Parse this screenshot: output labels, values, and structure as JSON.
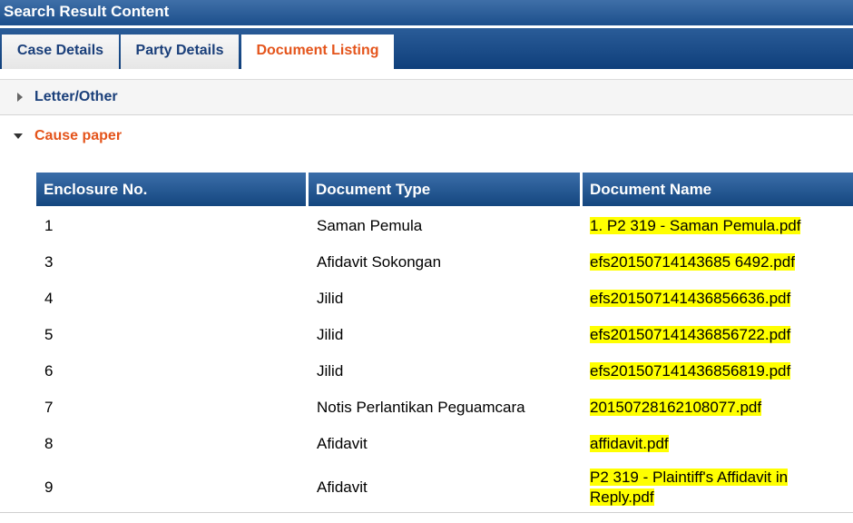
{
  "header": {
    "title": "Search Result Content"
  },
  "tabs": {
    "case_details": "Case Details",
    "party_details": "Party Details",
    "document_listing": "Document Listing",
    "active": "Document Listing"
  },
  "sections": {
    "letter_other": "Letter/Other",
    "cause_paper": "Cause paper"
  },
  "table": {
    "columns": {
      "enclosure": "Enclosure No.",
      "type": "Document Type",
      "name": "Document Name"
    },
    "rows": [
      {
        "enclosure": "1",
        "type": "Saman Pemula",
        "name": "1. P2 319 - Saman Pemula.pdf"
      },
      {
        "enclosure": "3",
        "type": "Afidavit Sokongan",
        "name": "efs20150714143685 6492.pdf"
      },
      {
        "enclosure": "4",
        "type": "Jilid",
        "name": "efs201507141436856636.pdf"
      },
      {
        "enclosure": "5",
        "type": "Jilid",
        "name": "efs201507141436856722.pdf"
      },
      {
        "enclosure": "6",
        "type": "Jilid",
        "name": "efs201507141436856819.pdf"
      },
      {
        "enclosure": "7",
        "type": "Notis Perlantikan Peguamcara",
        "name": "20150728162108077.pdf"
      },
      {
        "enclosure": "8",
        "type": "Afidavit",
        "name": "affidavit.pdf"
      },
      {
        "enclosure": "9",
        "type": "Afidavit",
        "name": "P2 319 - Plaintiff's Affidavit in Reply.pdf"
      }
    ]
  },
  "colors": {
    "header_blue": "#1c4f8c",
    "active_tab": "#e4541b",
    "link_highlight": "#ffff00"
  }
}
